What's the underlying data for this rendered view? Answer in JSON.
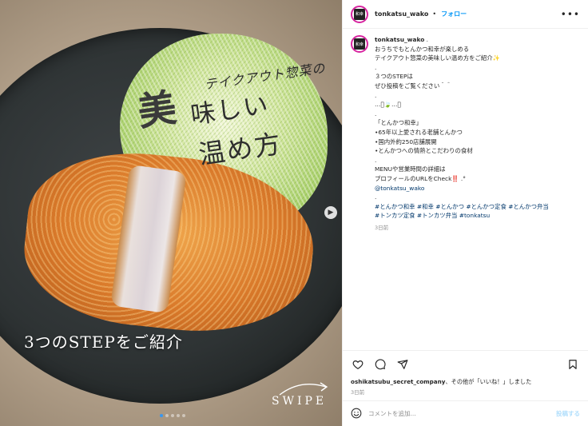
{
  "media": {
    "overlay_small": "テイクアウト惣菜の",
    "overlay_big_1": "美",
    "overlay_big_2": "味しい",
    "overlay_big_3": "温め方",
    "step_text": "3つのSTEPをご紹介",
    "swipe_text": "SWIPE",
    "next_icon": "chevron-right-icon",
    "carousel_total": 5,
    "carousel_active": 1
  },
  "header": {
    "username": "tonkatsu_wako",
    "separator": "•",
    "follow_label": "フォロー",
    "more_icon": "more-horizontal-icon",
    "avatar_text": "和幸"
  },
  "caption": {
    "username": "tonkatsu_wako",
    "lines": [
      ".",
      "おうちでもとんかつ和幸が楽しめる",
      "テイクアウト惣菜の美味しい温め方をご紹介✨",
      ".",
      "３つのSTEPは",
      "ぜひ投稿をご覧ください＾＾",
      ".",
      "…ﾟ🍃…ﾟ",
      ".",
      "「とんかつ和幸」",
      "•65年以上愛される老舗とんかつ",
      "•国内外約250店舗展開",
      "•とんかつへの情熱とこだわりの食材",
      ".",
      "MENUや営業時間の詳細は",
      "プロフィールのURLをCheck‼️ .°"
    ],
    "mention": "@tonkatsu_wako",
    "dot_after_mention": ".",
    "hashtags_line_1": "#とんかつ和幸 #和幸 #とんかつ #とんかつ定食 #とんかつ弁当",
    "hashtags_line_2": "#トンカツ定食 #トンカツ弁当 #tonkatsu",
    "time_ago": "3日前"
  },
  "actions": {
    "like_icon": "heart-icon",
    "comment_icon": "comment-icon",
    "share_icon": "send-icon",
    "save_icon": "bookmark-icon"
  },
  "likes": {
    "liked_by_user": "oshikatsubu_secret_company",
    "liked_by_rest": "、その他が「いいね！」しました",
    "others_bold": "その他"
  },
  "date": "3日前",
  "comment": {
    "emoji_icon": "smiley-icon",
    "placeholder": "コメントを追加...",
    "post_label": "投稿する"
  },
  "colors": {
    "accent": "#0095f6",
    "hashtag": "#00376b",
    "muted": "#8e8e8e",
    "post_disabled": "#b2dffc"
  }
}
